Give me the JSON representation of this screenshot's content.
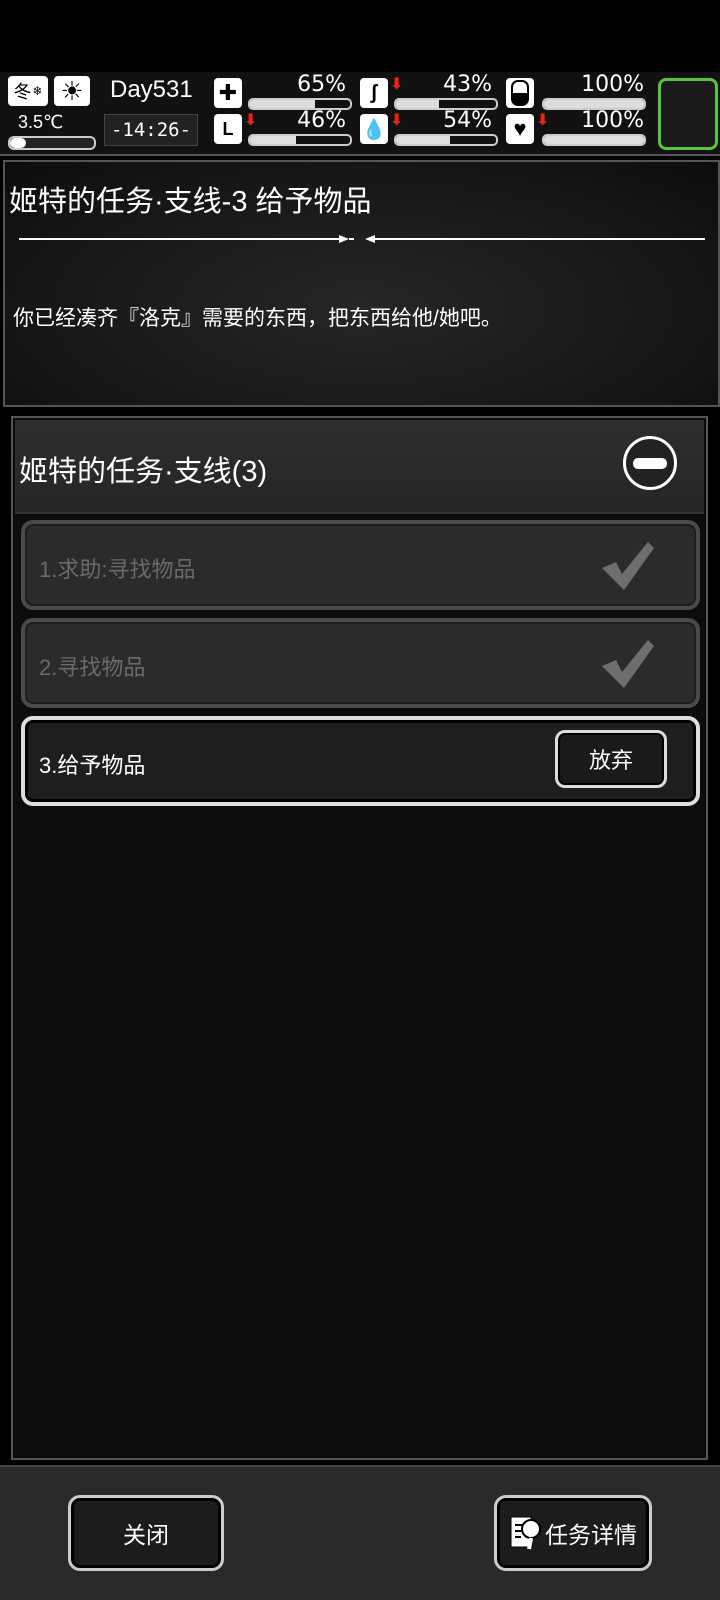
{
  "status": {
    "season": "冬",
    "temperature": "3.5℃",
    "day": "Day531",
    "time": "-14:26-",
    "stats": [
      {
        "name": "health",
        "icon": "medkit-icon",
        "value": "65%",
        "level": 0.65,
        "down": false
      },
      {
        "name": "hunger",
        "icon": "stomach-icon",
        "value": "43%",
        "level": 0.43,
        "down": true
      },
      {
        "name": "medicine",
        "icon": "pill-icon",
        "value": "100%",
        "level": 1.0,
        "down": false
      },
      {
        "name": "stamina",
        "icon": "boot-icon",
        "value": "46%",
        "level": 0.46,
        "down": true
      },
      {
        "name": "thirst",
        "icon": "water-drop-icon",
        "value": "54%",
        "level": 0.54,
        "down": true
      },
      {
        "name": "mood",
        "icon": "heart-icon",
        "value": "100%",
        "level": 1.0,
        "down": true
      }
    ]
  },
  "quest_detail": {
    "title": "姬特的任务·支线-3 给予物品",
    "description": "你已经凑齐『洛克』需要的东西，把东西给他/她吧。"
  },
  "quest_chain": {
    "title": "姬特的任务·支线(3)",
    "steps": [
      {
        "label": "1.求助:寻找物品",
        "status": "done"
      },
      {
        "label": "2.寻找物品",
        "status": "done"
      },
      {
        "label": "3.给予物品",
        "status": "active"
      }
    ],
    "abandon_label": "放弃"
  },
  "bottom": {
    "close_label": "关闭",
    "details_label": "任务详情"
  },
  "colors": {
    "accent_green": "#5bc23e",
    "alert_red": "#e21111"
  }
}
